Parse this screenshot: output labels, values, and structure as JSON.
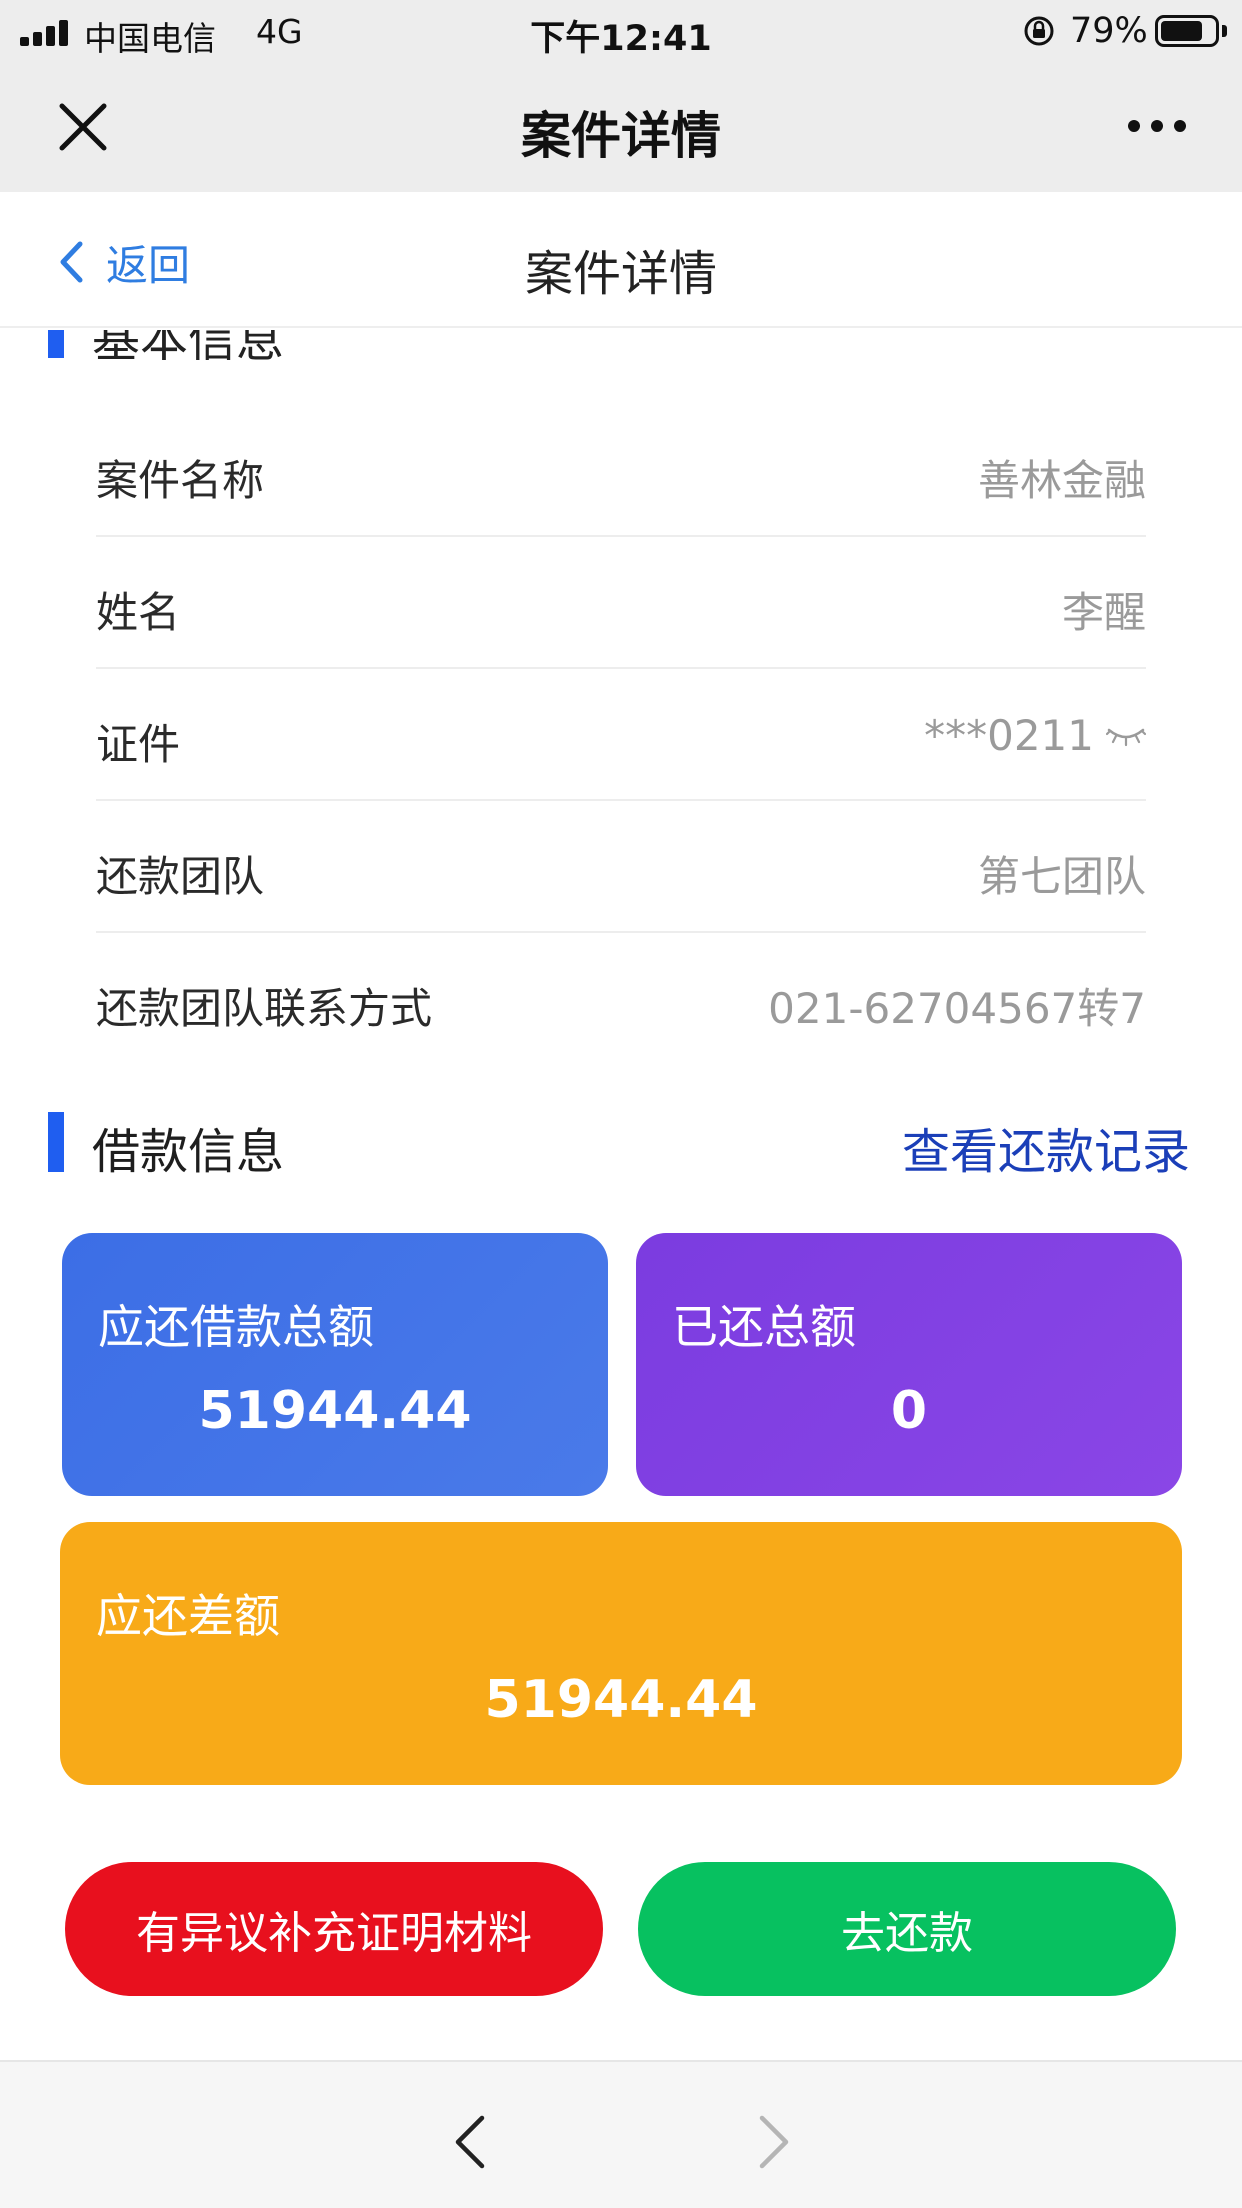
{
  "status_bar": {
    "carrier": "中国电信",
    "network": "4G",
    "time": "下午12:41",
    "battery": "79%",
    "battery_level": 0.79
  },
  "wechat_nav": {
    "title": "案件详情",
    "close_icon": "close-icon",
    "more_icon": "more-dots-icon"
  },
  "page_header": {
    "back_label": "返回",
    "title": "案件详情"
  },
  "basic_info": {
    "section_title": "基本信息",
    "rows": [
      {
        "label": "案件名称",
        "value": "善林金融"
      },
      {
        "label": "姓名",
        "value": "李醒"
      },
      {
        "label": "证件",
        "value": "***0211"
      },
      {
        "label": "还款团队",
        "value": "第七团队"
      },
      {
        "label": "还款团队联系方式",
        "value": "021-62704567转7"
      }
    ]
  },
  "loan_info": {
    "section_title": "借款信息",
    "record_link": "查看还款记录",
    "cards": {
      "total_due": {
        "label": "应还借款总额",
        "value": "51944.44",
        "color": "#3c6ee6"
      },
      "total_paid": {
        "label": "已还总额",
        "value": "0",
        "color": "#7b3ce0"
      },
      "balance_due": {
        "label": "应还差额",
        "value": "51944.44",
        "color": "#f8aa18"
      }
    }
  },
  "actions": {
    "dispute_label": "有异议补充证明材料",
    "dispute_color": "#e8101e",
    "repay_label": "去还款",
    "repay_color": "#07c160"
  },
  "colors": {
    "accent_blue": "#2f7de1",
    "section_marker": "#1f5ef0",
    "link": "#1b3fb8"
  }
}
